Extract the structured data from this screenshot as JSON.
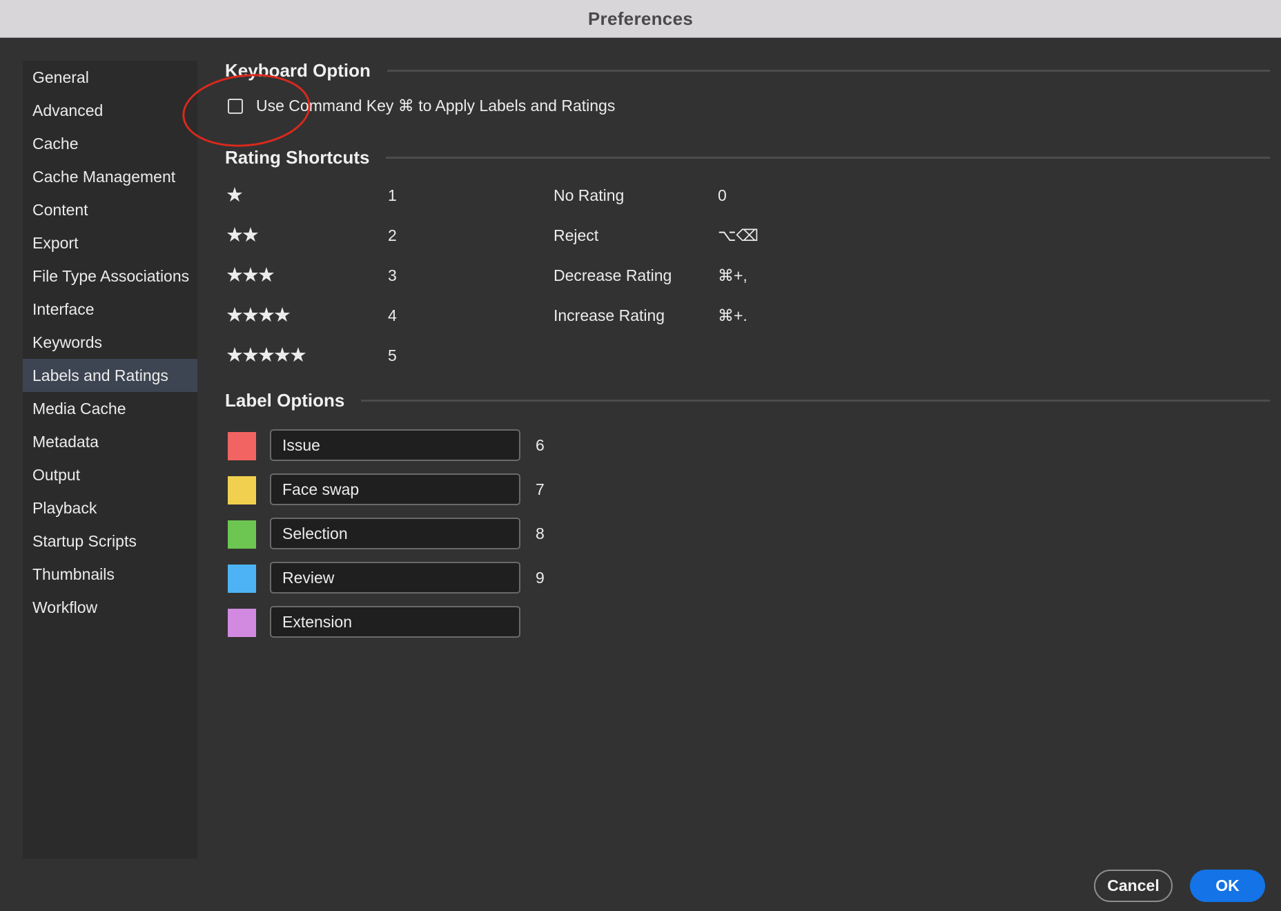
{
  "window": {
    "title": "Preferences"
  },
  "sidebar": {
    "items": [
      {
        "label": "General"
      },
      {
        "label": "Advanced"
      },
      {
        "label": "Cache"
      },
      {
        "label": "Cache Management"
      },
      {
        "label": "Content"
      },
      {
        "label": "Export"
      },
      {
        "label": "File Type Associations"
      },
      {
        "label": "Interface"
      },
      {
        "label": "Keywords"
      },
      {
        "label": "Labels and Ratings"
      },
      {
        "label": "Media Cache"
      },
      {
        "label": "Metadata"
      },
      {
        "label": "Output"
      },
      {
        "label": "Playback"
      },
      {
        "label": "Startup Scripts"
      },
      {
        "label": "Thumbnails"
      },
      {
        "label": "Workflow"
      }
    ],
    "selected": "Labels and Ratings"
  },
  "keyboard_option": {
    "title": "Keyboard Option",
    "checkbox_label": "Use Command Key ⌘ to Apply Labels and Ratings",
    "checked": false
  },
  "rating_shortcuts": {
    "title": "Rating Shortcuts",
    "star_rows": [
      {
        "stars": "★",
        "key": "1"
      },
      {
        "stars": "★★",
        "key": "2"
      },
      {
        "stars": "★★★",
        "key": "3"
      },
      {
        "stars": "★★★★",
        "key": "4"
      },
      {
        "stars": "★★★★★",
        "key": "5"
      }
    ],
    "actions": [
      {
        "name": "No Rating",
        "key": "0"
      },
      {
        "name": "Reject",
        "key": "⌥⌫"
      },
      {
        "name": "Decrease Rating",
        "key": "⌘+,"
      },
      {
        "name": "Increase Rating",
        "key": "⌘+."
      }
    ]
  },
  "label_options": {
    "title": "Label Options",
    "labels": [
      {
        "name": "Issue",
        "color": "#f26461",
        "key": "6"
      },
      {
        "name": "Face swap",
        "color": "#f2d04f",
        "key": "7"
      },
      {
        "name": "Selection",
        "color": "#6cc651",
        "key": "8"
      },
      {
        "name": "Review",
        "color": "#4db3f4",
        "key": "9"
      },
      {
        "name": "Extension",
        "color": "#d18ae0",
        "key": ""
      }
    ]
  },
  "buttons": {
    "cancel": "Cancel",
    "ok": "OK"
  },
  "colors": {
    "accent": "#1473e6",
    "annotation": "#d9291c",
    "selected_item": "#3d4452"
  }
}
